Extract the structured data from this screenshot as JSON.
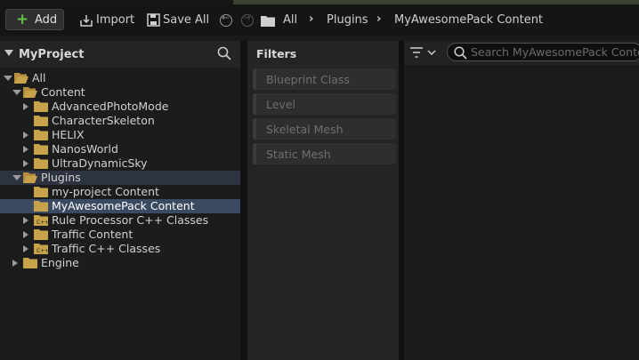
{
  "toolbar": {
    "add_label": "Add",
    "import_label": "Import",
    "save_all_label": "Save All"
  },
  "breadcrumb": [
    "All",
    "Plugins",
    "MyAwesomePack Content"
  ],
  "sources": {
    "title": "MyProject",
    "tree": [
      {
        "label": "All"
      },
      {
        "label": "Content"
      },
      {
        "label": "AdvancedPhotoMode"
      },
      {
        "label": "CharacterSkeleton"
      },
      {
        "label": "HELIX"
      },
      {
        "label": "NanosWorld"
      },
      {
        "label": "UltraDynamicSky"
      },
      {
        "label": "Plugins"
      },
      {
        "label": "my-project Content"
      },
      {
        "label": "MyAwesomePack Content"
      },
      {
        "label": "Rule Processor C++ Classes"
      },
      {
        "label": "Traffic Content"
      },
      {
        "label": "Traffic C++ Classes"
      },
      {
        "label": "Engine"
      }
    ]
  },
  "filters": {
    "title": "Filters",
    "items": [
      "Blueprint Class",
      "Level",
      "Skeletal Mesh",
      "Static Mesh"
    ]
  },
  "search": {
    "placeholder": "Search MyAwesomePack Content"
  },
  "colors": {
    "folder": "#c8a24a",
    "accent_add": "#63c148",
    "selection": "#3a4a63"
  }
}
